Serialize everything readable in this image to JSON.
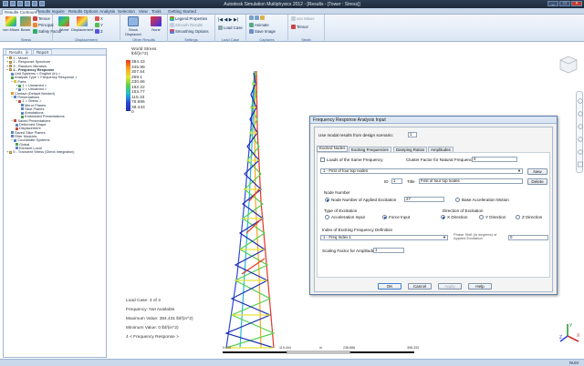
{
  "app": {
    "title": "Autodesk Simulation Multiphysics 2012 - [Results - [Tower : Stress]]"
  },
  "ribbon": {
    "tabs": [
      "Results Contours",
      "Results Inquire",
      "Results Options",
      "Analysis",
      "Selection",
      "View",
      "Tools",
      "Getting Started"
    ],
    "active_tab": "Results Contours",
    "groups": [
      "Stress",
      "Displacement",
      "Other Results",
      "Settings",
      "Load Case Options",
      "Captures",
      "Strain"
    ],
    "buttons": {
      "von_mises": "von Mises",
      "beam": "Beam",
      "tensor": "Tensor",
      "principal": "Principal",
      "safety_factor": "Safety Factor",
      "worst": "Worst",
      "displacement": "Displacement",
      "x": "X",
      "y": "Y",
      "z": "Z",
      "show_displaced": "Show Displaced",
      "none": "None",
      "legend_properties": "Legend Properties",
      "smooth_results": "Smooth Results",
      "smoothing_options": "Smoothing Options",
      "load_case": "Load Case",
      "animate": "Animate",
      "save_image": "Save Image",
      "tensor2": "Tensor",
      "von_mises2": "von Mises"
    }
  },
  "tree": {
    "tabs": [
      "FEA Editor",
      "Results",
      "Report"
    ],
    "active_tab": "Results",
    "items": [
      "1 - Model",
      "2 - Response Spectrum",
      "3 - Random Vibration",
      "4 - Frequency Response",
      "Unit Systems < English (in) >",
      "Analysis Type < Frequency Response >",
      "Parts",
      "1 < Unnamed >",
      "2 < Unnamed >",
      "Contact (Default Bonded)",
      "Presentations",
      "1 < Stress >",
      "Mirror Planes",
      "Slice Planes",
      "Annotations",
      "Embedded Presentations",
      "Saved Presentations",
      "Deformed Shape",
      "Displacement",
      "Saved Slice Planes",
      "Filter Modules",
      "Coordinate Systems",
      "Global",
      "Element Local",
      "5 - Transient Stress (Direct Integration)"
    ]
  },
  "legend": {
    "title": "World Stress",
    "unit": "lbf/(in^2)",
    "values": [
      "384.43",
      "345.99",
      "307.54",
      "269.1",
      "230.66",
      "192.22",
      "153.77",
      "115.33",
      "76.886",
      "38.443",
      "0"
    ],
    "colors": [
      "#e73522",
      "#f7a520",
      "#e7e436",
      "#55d04d",
      "#28b8d8",
      "#2f49d8",
      "#1c2fb3"
    ]
  },
  "info": {
    "load_case": "Load Case:  3 of 3",
    "frequency": "Frequency: Not Available",
    "maximum": "Maximum Value: 384.431 lbf/(in^2)",
    "minimum": "Minimum Value: 0 lbf/(in^2)",
    "analysis": "4 < Frequency Response >"
  },
  "ruler": {
    "ticks": [
      "0.000",
      "119.444",
      "in",
      "238.888",
      "358.333"
    ]
  },
  "dialog": {
    "title": "Frequency Response Analysis Input",
    "use_model_label": "Use modal results from design scenario:",
    "use_model_value": "1",
    "tabs": [
      "Excited Nodes",
      "Exciting Frequencies",
      "Damping Ratios",
      "Amplitudes"
    ],
    "active_tab": "Excited Nodes",
    "loads_same_freq": "Loads of the Same Frequency",
    "cluster_factor_label": "Cluster Factor for Natural Frequencies",
    "cluster_factor_value": "0",
    "load_set_selected": "1 - First of four top nodes",
    "new_button": "New",
    "delete_button": "Delete",
    "id_label": "ID",
    "id_value": "1",
    "title_label": "Title",
    "title_value": "First of four top nodes",
    "node_number_heading": "Node Number",
    "node_applied_label": "Node Number of Applied Excitation",
    "node_applied_value": "27",
    "base_accel_label": "Base Acceleration Motion",
    "type_excitation_heading": "Type of Excitation",
    "accel_input": "Acceleration Input",
    "force_input": "Force Input",
    "direction_heading": "Direction of Excitation",
    "x_dir": "X Direction",
    "y_dir": "Y Direction",
    "z_dir": "Z Direction",
    "index_heading": "Index of Exciting Frequency Definition",
    "index_selected": "1 - Freq Index 1",
    "phase_label": "Phase Shift (in degrees) of Applied Excitation",
    "phase_value": "0",
    "scaling_label": "Scaling Factor for Amplitudes",
    "scaling_value": "1",
    "ok": "OK",
    "cancel": "Cancel",
    "apply": "Apply",
    "help": "Help"
  },
  "statusbar": {
    "right": "NUM"
  }
}
